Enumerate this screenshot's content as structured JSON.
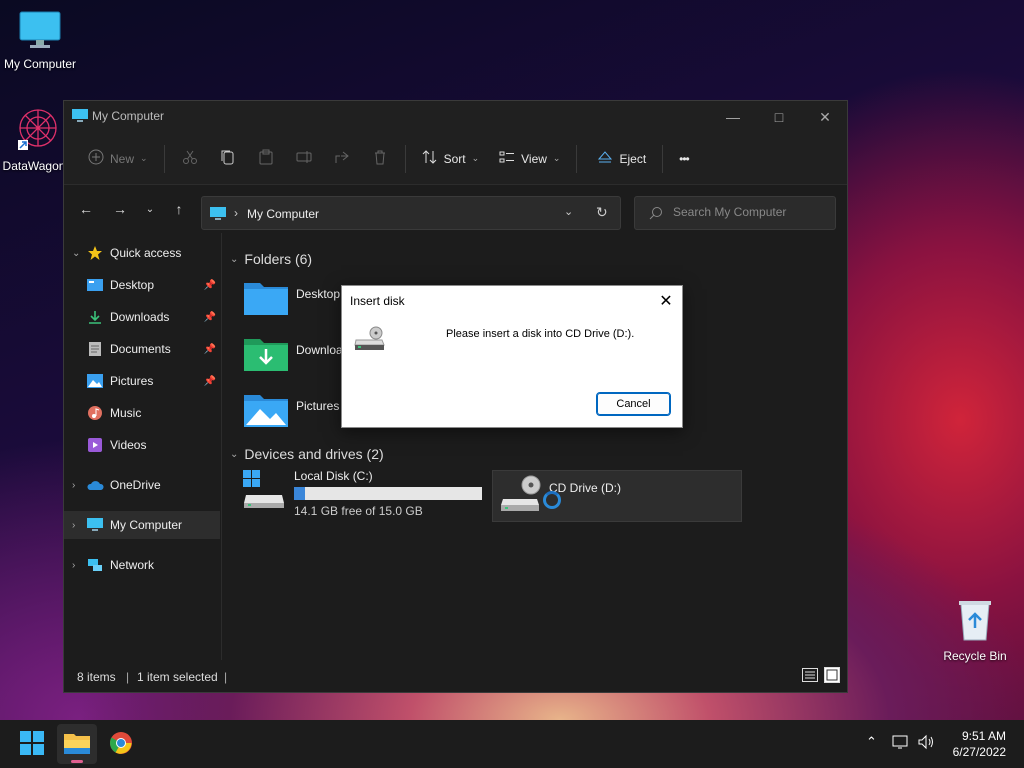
{
  "desktop": {
    "icons": [
      {
        "label": "My Computer"
      },
      {
        "label": "DataWagon"
      },
      {
        "label": "Recycle Bin"
      }
    ]
  },
  "window": {
    "title": "My Computer",
    "toolbar": {
      "new_label": "New",
      "sort_label": "Sort",
      "view_label": "View",
      "eject_label": "Eject",
      "more_label": "•••"
    },
    "address": {
      "crumb": "My Computer",
      "search_placeholder": "Search My Computer"
    },
    "sidebar": {
      "items": [
        {
          "label": "Quick access",
          "icon": "star-icon"
        },
        {
          "label": "Desktop",
          "icon": "desktop-folder-icon",
          "pinned": true
        },
        {
          "label": "Downloads",
          "icon": "download-icon",
          "pinned": true
        },
        {
          "label": "Documents",
          "icon": "document-icon",
          "pinned": true
        },
        {
          "label": "Pictures",
          "icon": "pictures-icon",
          "pinned": true
        },
        {
          "label": "Music",
          "icon": "music-icon"
        },
        {
          "label": "Videos",
          "icon": "videos-icon"
        },
        {
          "label": "OneDrive",
          "icon": "cloud-icon"
        },
        {
          "label": "My Computer",
          "icon": "computer-icon",
          "selected": true
        },
        {
          "label": "Network",
          "icon": "network-icon"
        }
      ]
    },
    "content": {
      "folders_header": "Folders (6)",
      "folders": [
        {
          "label": "Desktop"
        },
        {
          "label": "Downloa"
        },
        {
          "label": "Pictures"
        }
      ],
      "drives_header": "Devices and drives (2)",
      "drives": [
        {
          "label": "Local Disk (C:)",
          "info": "14.1 GB free of 15.0 GB",
          "used_fraction": 0.06
        },
        {
          "label": "CD Drive (D:)"
        }
      ]
    },
    "status": {
      "items": "8 items",
      "selected": "1 item selected"
    }
  },
  "dialog": {
    "title": "Insert disk",
    "message": "Please insert a disk into CD Drive (D:).",
    "cancel_label": "Cancel"
  },
  "taskbar": {
    "time": "9:51 AM",
    "date": "6/27/2022"
  },
  "colors": {
    "accent": "#0067c0",
    "folder_blue": "#3aa0f0",
    "drive_bar": "#3a86d9"
  }
}
